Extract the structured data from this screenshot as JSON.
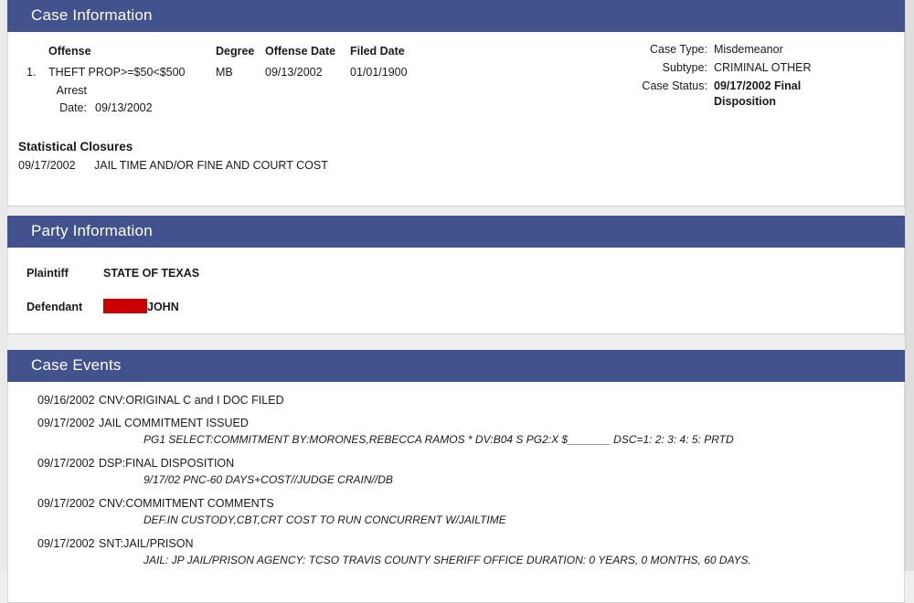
{
  "sections": {
    "case_information": {
      "title": "Case Information",
      "offense_columns": {
        "offense": "Offense",
        "degree": "Degree",
        "offense_date": "Offense Date",
        "filed_date": "Filed Date"
      },
      "offenses": [
        {
          "num": "1.",
          "description": "THEFT PROP>=$50<$500",
          "degree": "MB",
          "offense_date": "09/13/2002",
          "filed_date": "01/01/1900"
        }
      ],
      "arrest": {
        "label_line1": "Arrest",
        "label_line2": "Date:",
        "value": "09/13/2002"
      },
      "meta": {
        "case_type_label": "Case Type:",
        "case_type_value": "Misdemeanor",
        "subtype_label": "Subtype:",
        "subtype_value": "CRIMINAL OTHER",
        "case_status_label": "Case Status:",
        "case_status_value": "09/17/2002  Final Disposition"
      },
      "statistical_closures": {
        "title": "Statistical Closures",
        "rows": [
          {
            "date": "09/17/2002",
            "text": "JAIL TIME AND/OR FINE AND COURT COST"
          }
        ]
      }
    },
    "party_information": {
      "title": "Party Information",
      "plaintiff": {
        "label": "Plaintiff",
        "value": "STATE OF TEXAS"
      },
      "defendant": {
        "label": "Defendant",
        "redacted": true,
        "value": "JOHN"
      }
    },
    "case_events": {
      "title": "Case Events",
      "events": [
        {
          "date": "09/16/2002",
          "description": "CNV:ORIGINAL C and I DOC FILED",
          "detail": ""
        },
        {
          "date": "09/17/2002",
          "description": "JAIL COMMITMENT ISSUED",
          "detail": "PG1 SELECT:COMMITMENT BY:MORONES,REBECCA RAMOS * DV:B04 S PG2:X $_______   DSC=1: 2: 3: 4: 5: PRTD"
        },
        {
          "date": "09/17/2002",
          "description": "DSP:FINAL DISPOSITION",
          "detail": "9/17/02 PNC-60 DAYS+COST//JUDGE CRAIN//DB"
        },
        {
          "date": "09/17/2002",
          "description": "CNV:COMMITMENT COMMENTS",
          "detail": "DEF.IN CUSTODY,CBT,CRT COST TO RUN CONCURRENT W/JAILTIME"
        },
        {
          "date": "09/17/2002",
          "description": "SNT:JAIL/PRISON",
          "detail": "JAIL: JP JAIL/PRISON AGENCY: TCSO TRAVIS COUNTY SHERIFF OFFICE DURATION: 0 YEARS, 0 MONTHS, 60 DAYS."
        }
      ]
    }
  },
  "colors": {
    "header_blue": "#42528d",
    "redaction_red": "#cc0000",
    "page_background": "#eeeeee"
  }
}
